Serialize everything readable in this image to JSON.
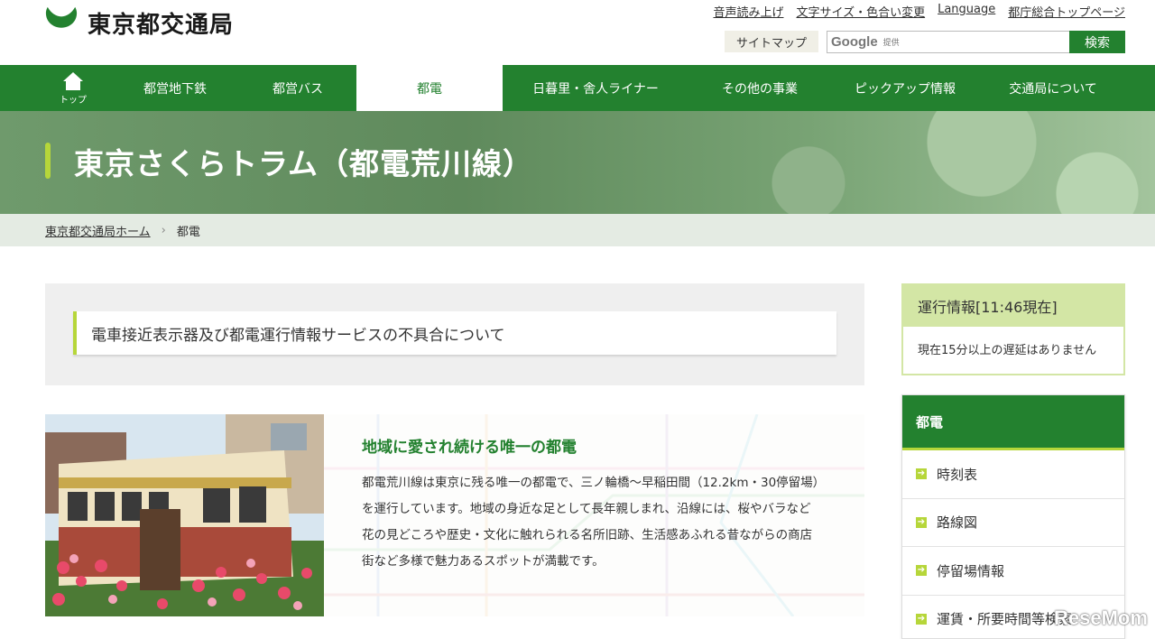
{
  "header": {
    "logo_text": "東京都交通局",
    "util_links": [
      "音声読み上げ",
      "文字サイズ・色合い変更",
      "Language",
      "都庁総合トップページ"
    ],
    "sitemap_label": "サイトマップ",
    "search": {
      "google_label": "Google",
      "google_sub": "提供",
      "button_label": "検索"
    }
  },
  "nav": {
    "items": [
      {
        "label": "トップ"
      },
      {
        "label": "都営地下鉄"
      },
      {
        "label": "都営バス"
      },
      {
        "label": "都電"
      },
      {
        "label": "日暮里・舎人ライナー"
      },
      {
        "label": "その他の事業"
      },
      {
        "label": "ピックアップ情報"
      },
      {
        "label": "交通局について"
      }
    ],
    "active": "都電"
  },
  "banner": {
    "title": "東京さくらトラム（都電荒川線）"
  },
  "breadcrumb": {
    "home": "東京都交通局ホーム",
    "current": "都電"
  },
  "notice": {
    "text": "電車接近表示器及び都電運行情報サービスの不具合について"
  },
  "feature": {
    "title": "地域に愛され続ける唯一の都電",
    "body": "都電荒川線は東京に残る唯一の都電で、三ノ輪橋～早稲田間（12.2km・30停留場）を運行しています。地域の身近な足として長年親しまれ、沿線には、桜やバラなど花の見どころや歴史・文化に触れられる名所旧跡、生活感あふれる昔ながらの商店街など多様で魅力あるスポットが満載です。"
  },
  "sidebar": {
    "status": {
      "title": "運行情報[11:46現在]",
      "message": "現在15分以上の遅延はありません"
    },
    "menu_title": "都電",
    "menu_items": [
      "時刻表",
      "路線図",
      "停留場情報",
      "運賃・所要時間等検索"
    ]
  },
  "watermark": "ReseMom",
  "colors": {
    "brand_green": "#23812f",
    "accent_lime": "#b6d63a",
    "status_bg": "#d3e6a5"
  }
}
